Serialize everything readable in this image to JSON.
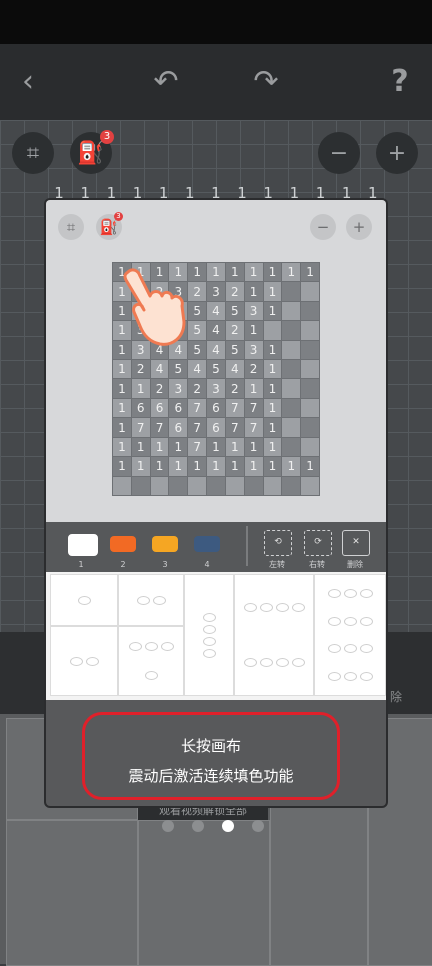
{
  "toolbar": {
    "back_icon": "‹",
    "undo_icon": "↶",
    "redo_icon": "↷",
    "help_label": "?"
  },
  "canvas_tools": {
    "select_icon": "⌗",
    "fill_icon": "⛽",
    "fill_badge": "3",
    "zoom_out_icon": "−",
    "zoom_in_icon": "+"
  },
  "top_ruler": [
    "1",
    "1",
    "1",
    "1",
    "1",
    "1",
    "1",
    "1",
    "1",
    "1",
    "1",
    "1",
    "1"
  ],
  "modal": {
    "preview_grid": [
      [
        "1",
        "1",
        "1",
        "1",
        "1",
        "1",
        "1",
        "1",
        "1",
        "1",
        "1"
      ],
      [
        "1",
        "1",
        "2",
        "3",
        "2",
        "3",
        "2",
        "1",
        "1",
        "",
        ""
      ],
      [
        "1",
        "3",
        "4",
        "4",
        "5",
        "4",
        "5",
        "3",
        "1",
        "",
        ""
      ],
      [
        "1",
        "3",
        "4",
        "4",
        "5",
        "4",
        "2",
        "1",
        "",
        "",
        ""
      ],
      [
        "1",
        "3",
        "4",
        "4",
        "5",
        "4",
        "5",
        "3",
        "1",
        "",
        ""
      ],
      [
        "1",
        "2",
        "4",
        "5",
        "4",
        "5",
        "4",
        "2",
        "1",
        "",
        ""
      ],
      [
        "1",
        "1",
        "2",
        "3",
        "2",
        "3",
        "2",
        "1",
        "1",
        "",
        ""
      ],
      [
        "1",
        "6",
        "6",
        "6",
        "7",
        "6",
        "7",
        "7",
        "1",
        "",
        ""
      ],
      [
        "1",
        "7",
        "7",
        "6",
        "7",
        "6",
        "7",
        "7",
        "1",
        "",
        ""
      ],
      [
        "1",
        "1",
        "1",
        "1",
        "7",
        "1",
        "1",
        "1",
        "1",
        "",
        ""
      ],
      [
        "1",
        "1",
        "1",
        "1",
        "1",
        "1",
        "1",
        "1",
        "1",
        "1",
        "1"
      ],
      [
        "",
        "",
        "",
        "",
        "",
        "",
        "",
        "",
        "",
        "",
        ""
      ]
    ],
    "palette": [
      {
        "label": "1",
        "color": "#ffffff"
      },
      {
        "label": "2",
        "color": "#f26a24"
      },
      {
        "label": "3",
        "color": "#f5a623"
      },
      {
        "label": "4",
        "color": "#3d5a80"
      }
    ],
    "actions": {
      "rotate_left": "左转",
      "rotate_right": "右转",
      "delete": "删除"
    },
    "tip_line1": "长按画布",
    "tip_line2": "震动后激活连续填色功能"
  },
  "behind": {
    "delete_partial": "除",
    "video_hint": "观看视频解锁全部"
  },
  "pager": {
    "count": 4,
    "active": 3
  }
}
